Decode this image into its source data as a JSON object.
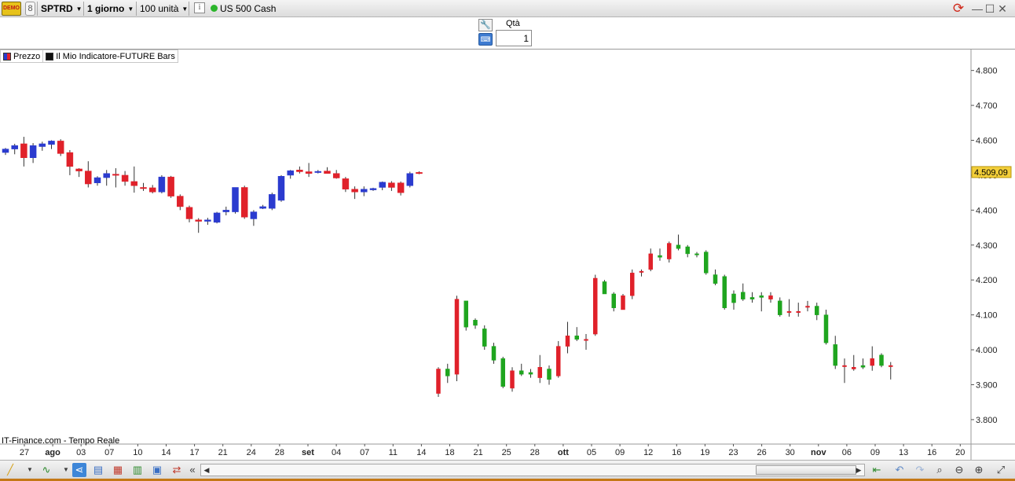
{
  "toolbar": {
    "logo_text": "DEMO",
    "symbol": "SPTRD",
    "timeframe": "1 giorno",
    "units": "100 unità",
    "instrument": "US 500 Cash",
    "status_color": "#2bb52b"
  },
  "order": {
    "qty_label": "Qtà",
    "qty_value": "1"
  },
  "legend": [
    {
      "label": "Prezzo",
      "color": "#2b3bcf",
      "color2": "#e0212a"
    },
    {
      "label": "Il Mio Indicatore-FUTURE Bars",
      "color": "#111111",
      "color2": "#111111"
    }
  ],
  "source_label": "IT-Finance.com - Tempo Reale",
  "window_controls": [
    "—",
    "☐",
    "✕"
  ],
  "chart_data": {
    "type": "candlestick",
    "y_ticks": [
      "4.800",
      "4.700",
      "4.600",
      "4.500",
      "4.400",
      "4.300",
      "4.200",
      "4.100",
      "4.000",
      "3.900",
      "3.800"
    ],
    "ylim": [
      3730,
      4860
    ],
    "last_price_label": "4.509,09",
    "last_price": 4509,
    "x_labels": [
      {
        "text": "27",
        "bold": false
      },
      {
        "text": "ago",
        "bold": true
      },
      {
        "text": "03",
        "bold": false
      },
      {
        "text": "07",
        "bold": false
      },
      {
        "text": "10",
        "bold": false
      },
      {
        "text": "14",
        "bold": false
      },
      {
        "text": "17",
        "bold": false
      },
      {
        "text": "21",
        "bold": false
      },
      {
        "text": "24",
        "bold": false
      },
      {
        "text": "28",
        "bold": false
      },
      {
        "text": "set",
        "bold": true
      },
      {
        "text": "04",
        "bold": false
      },
      {
        "text": "07",
        "bold": false
      },
      {
        "text": "11",
        "bold": false
      },
      {
        "text": "14",
        "bold": false
      },
      {
        "text": "18",
        "bold": false
      },
      {
        "text": "21",
        "bold": false
      },
      {
        "text": "25",
        "bold": false
      },
      {
        "text": "28",
        "bold": false
      },
      {
        "text": "ott",
        "bold": true
      },
      {
        "text": "05",
        "bold": false
      },
      {
        "text": "09",
        "bold": false
      },
      {
        "text": "12",
        "bold": false
      },
      {
        "text": "16",
        "bold": false
      },
      {
        "text": "19",
        "bold": false
      },
      {
        "text": "23",
        "bold": false
      },
      {
        "text": "26",
        "bold": false
      },
      {
        "text": "30",
        "bold": false
      },
      {
        "text": "nov",
        "bold": true
      },
      {
        "text": "06",
        "bold": false
      },
      {
        "text": "09",
        "bold": false
      },
      {
        "text": "13",
        "bold": false
      },
      {
        "text": "16",
        "bold": false
      },
      {
        "text": "20",
        "bold": false
      }
    ],
    "series": [
      {
        "name": "Prezzo",
        "up_color": "#2b3bcf",
        "down_color": "#e0212a",
        "ohlc": [
          [
            4565,
            4578,
            4558,
            4575
          ],
          [
            4575,
            4590,
            4560,
            4585
          ],
          [
            4590,
            4610,
            4525,
            4550
          ],
          [
            4550,
            4592,
            4535,
            4585
          ],
          [
            4582,
            4596,
            4570,
            4590
          ],
          [
            4588,
            4600,
            4575,
            4598
          ],
          [
            4598,
            4603,
            4555,
            4562
          ],
          [
            4565,
            4572,
            4500,
            4525
          ],
          [
            4518,
            4520,
            4495,
            4512
          ],
          [
            4512,
            4540,
            4465,
            4475
          ],
          [
            4478,
            4497,
            4470,
            4493
          ],
          [
            4493,
            4515,
            4470,
            4505
          ],
          [
            4503,
            4520,
            4465,
            4500
          ],
          [
            4500,
            4512,
            4470,
            4482
          ],
          [
            4482,
            4525,
            4450,
            4470
          ],
          [
            4465,
            4478,
            4455,
            4462
          ],
          [
            4464,
            4472,
            4448,
            4452
          ],
          [
            4452,
            4500,
            4448,
            4495
          ],
          [
            4495,
            4498,
            4435,
            4440
          ],
          [
            4440,
            4445,
            4400,
            4410
          ],
          [
            4408,
            4413,
            4365,
            4375
          ],
          [
            4372,
            4377,
            4335,
            4368
          ],
          [
            4368,
            4378,
            4358,
            4372
          ],
          [
            4365,
            4395,
            4362,
            4392
          ],
          [
            4395,
            4410,
            4385,
            4400
          ],
          [
            4395,
            4465,
            4390,
            4465
          ],
          [
            4465,
            4470,
            4375,
            4380
          ],
          [
            4375,
            4400,
            4355,
            4395
          ],
          [
            4405,
            4415,
            4403,
            4410
          ],
          [
            4405,
            4450,
            4400,
            4445
          ],
          [
            4428,
            4500,
            4424,
            4497
          ],
          [
            4500,
            4515,
            4490,
            4513
          ],
          [
            4515,
            4525,
            4505,
            4510
          ],
          [
            4510,
            4535,
            4495,
            4505
          ],
          [
            4508,
            4515,
            4505,
            4511
          ],
          [
            4512,
            4523,
            4505,
            4505
          ],
          [
            4505,
            4515,
            4490,
            4492
          ],
          [
            4490,
            4495,
            4452,
            4460
          ],
          [
            4460,
            4468,
            4432,
            4452
          ],
          [
            4452,
            4468,
            4440,
            4460
          ],
          [
            4458,
            4464,
            4455,
            4462
          ],
          [
            4465,
            4482,
            4457,
            4480
          ],
          [
            4478,
            4483,
            4455,
            4465
          ],
          [
            4478,
            4482,
            4442,
            4450
          ],
          [
            4470,
            4510,
            4465,
            4505
          ],
          [
            4508,
            4511,
            4503,
            4505
          ]
        ]
      },
      {
        "name": "Il Mio Indicatore-FUTURE Bars",
        "up_color": "#e0212a",
        "down_color": "#1fa51f",
        "ohlc": [
          [
            3875,
            3950,
            3865,
            3945
          ],
          [
            3945,
            3960,
            3905,
            3925
          ],
          [
            3930,
            4155,
            3910,
            4145
          ],
          [
            4140,
            4120,
            4055,
            4065
          ],
          [
            4085,
            4090,
            4060,
            4070
          ],
          [
            4060,
            4070,
            4000,
            4010
          ],
          [
            4010,
            4020,
            3960,
            3970
          ],
          [
            3975,
            3980,
            3890,
            3895
          ],
          [
            3890,
            3950,
            3880,
            3940
          ],
          [
            3940,
            3960,
            3925,
            3930
          ],
          [
            3935,
            3945,
            3920,
            3930
          ],
          [
            3920,
            3985,
            3905,
            3950
          ],
          [
            3945,
            3955,
            3900,
            3915
          ],
          [
            3925,
            4025,
            3920,
            4010
          ],
          [
            4010,
            4080,
            3990,
            4040
          ],
          [
            4040,
            4065,
            4025,
            4030
          ],
          [
            4030,
            4045,
            4000,
            4030
          ],
          [
            4045,
            4215,
            4040,
            4205
          ],
          [
            4195,
            4200,
            4160,
            4160
          ],
          [
            4160,
            4165,
            4110,
            4120
          ],
          [
            4115,
            4160,
            4115,
            4155
          ],
          [
            4155,
            4230,
            4145,
            4220
          ],
          [
            4225,
            4230,
            4210,
            4225
          ],
          [
            4230,
            4290,
            4225,
            4275
          ],
          [
            4270,
            4290,
            4255,
            4265
          ],
          [
            4260,
            4310,
            4250,
            4305
          ],
          [
            4300,
            4330,
            4285,
            4290
          ],
          [
            4295,
            4300,
            4265,
            4275
          ],
          [
            4275,
            4280,
            4265,
            4272
          ],
          [
            4280,
            4285,
            4215,
            4220
          ],
          [
            4215,
            4230,
            4185,
            4190
          ],
          [
            4210,
            4215,
            4115,
            4120
          ],
          [
            4160,
            4170,
            4115,
            4135
          ],
          [
            4165,
            4190,
            4140,
            4145
          ],
          [
            4150,
            4165,
            4135,
            4145
          ],
          [
            4155,
            4165,
            4110,
            4150
          ],
          [
            4145,
            4165,
            4135,
            4155
          ],
          [
            4140,
            4150,
            4095,
            4100
          ],
          [
            4110,
            4145,
            4095,
            4110
          ],
          [
            4110,
            4135,
            4095,
            4110
          ],
          [
            4125,
            4140,
            4110,
            4125
          ],
          [
            4125,
            4135,
            4085,
            4100
          ],
          [
            4100,
            4115,
            4015,
            4020
          ],
          [
            4015,
            4040,
            3945,
            3955
          ],
          [
            3955,
            3975,
            3905,
            3955
          ],
          [
            3945,
            3985,
            3940,
            3950
          ],
          [
            3955,
            3975,
            3945,
            3950
          ],
          [
            3955,
            4010,
            3940,
            3975
          ],
          [
            3985,
            3990,
            3950,
            3955
          ],
          [
            3955,
            3965,
            3915,
            3955
          ]
        ]
      }
    ]
  }
}
